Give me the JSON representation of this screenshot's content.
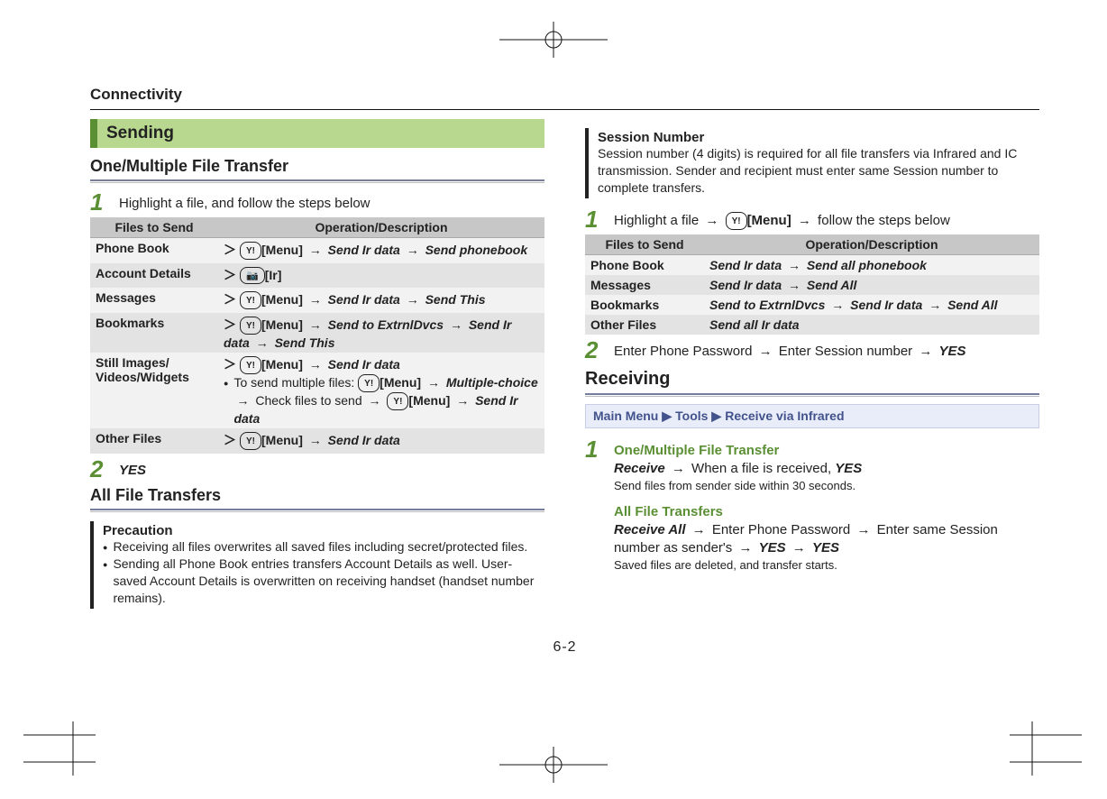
{
  "chapter": "Connectivity",
  "page_number": "6-2",
  "left": {
    "section": "Sending",
    "sub1": "One/Multiple File Transfer",
    "step1": "Highlight a file, and follow the steps below",
    "table1": {
      "h1": "Files to Send",
      "h2": "Operation/Description",
      "rows": {
        "r0": {
          "label": "Phone Book",
          "menu": "[Menu]",
          "a1": "Send Ir data",
          "a2": "Send phonebook"
        },
        "r1": {
          "label": "Account Details",
          "ir": "[Ir]"
        },
        "r2": {
          "label": "Messages",
          "menu": "[Menu]",
          "a1": "Send Ir data",
          "a2": "Send This"
        },
        "r3": {
          "label": "Bookmarks",
          "menu": "[Menu]",
          "a1": "Send to ExtrnlDvcs",
          "a2": "Send Ir data",
          "a3": "Send This"
        },
        "r4": {
          "label": "Still Images/\nVideos/Widgets",
          "menu": "[Menu]",
          "a1": "Send Ir data",
          "note_lead": "To send multiple files: ",
          "menu2": "[Menu]",
          "b1": "Multiple-choice",
          "note_mid": "Check files to send",
          "menu3": "[Menu]",
          "b2": "Send Ir data"
        },
        "r5": {
          "label": "Other Files",
          "menu": "[Menu]",
          "a1": "Send Ir data"
        }
      }
    },
    "step2": "YES",
    "sub2": "All File Transfers",
    "precaution": {
      "title": "Precaution",
      "b1": "Receiving all files overwrites all saved files including secret/protected files.",
      "b2": "Sending all Phone Book entries transfers Account Details as well. User-saved Account Details is overwritten on receiving handset (handset number remains)."
    }
  },
  "right": {
    "session": {
      "title": "Session Number",
      "body": "Session number (4 digits) is required for all file transfers via Infrared and IC transmission. Sender and recipient must enter same Session number to complete transfers."
    },
    "step1_pre": "Highlight a file ",
    "step1_menu": "[Menu]",
    "step1_post": " follow the steps below",
    "table2": {
      "h1": "Files to Send",
      "h2": "Operation/Description",
      "rows": {
        "r0": {
          "label": "Phone Book",
          "a1": "Send Ir data",
          "a2": "Send all phonebook"
        },
        "r1": {
          "label": "Messages",
          "a1": "Send Ir data",
          "a2": "Send All"
        },
        "r2": {
          "label": "Bookmarks",
          "a1": "Send to ExtrnlDvcs",
          "a2": "Send Ir data",
          "a3": "Send All"
        },
        "r3": {
          "label": "Other Files",
          "a1": "Send all Ir data"
        }
      }
    },
    "step2_pre": "Enter Phone Password ",
    "step2_mid": " Enter Session number ",
    "step2_yes": "YES",
    "receiving": "Receiving",
    "menu_strip": {
      "a": "Main Menu",
      "b": "Tools",
      "c": "Receive via Infrared"
    },
    "recv1": {
      "head": "One/Multiple File Transfer",
      "cmd": "Receive",
      "mid": " When a file is received, ",
      "yes": "YES",
      "note": "Send files from sender side within 30 seconds."
    },
    "recv2": {
      "head": "All File Transfers",
      "cmd": "Receive All",
      "mid1": " Enter Phone Password ",
      "mid2": " Enter same Session number as sender's ",
      "yes1": "YES",
      "yes2": "YES",
      "note": "Saved files are deleted, and transfer starts."
    }
  }
}
